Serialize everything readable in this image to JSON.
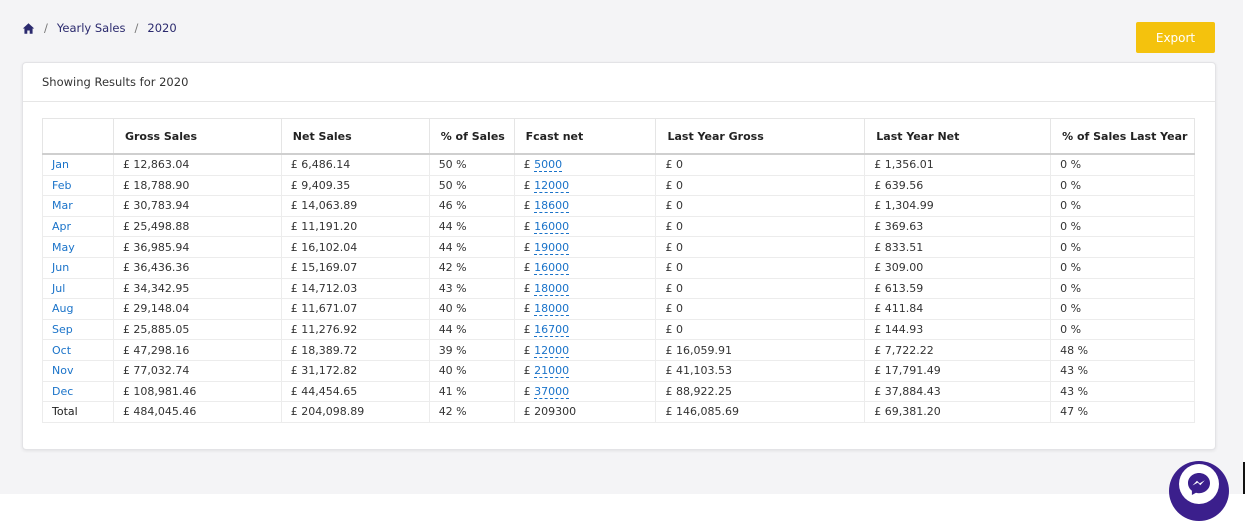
{
  "breadcrumb": {
    "home_icon": "home-icon",
    "separator": "/",
    "section": "Yearly Sales",
    "current": "2020"
  },
  "toolbar": {
    "export_label": "Export"
  },
  "card": {
    "header": "Showing Results for 2020"
  },
  "table": {
    "columns": [
      "",
      "Gross Sales",
      "Net Sales",
      "% of Sales",
      "Fcast net",
      "Last Year Gross",
      "Last Year Net",
      "% of Sales Last Year"
    ],
    "fcast_prefix": "£",
    "rows": [
      {
        "month": "Jan",
        "gross": "£ 12,863.04",
        "net": "£ 6,486.14",
        "pct": "50 %",
        "fcast": "5000",
        "ly_gross": "£ 0",
        "ly_net": "£ 1,356.01",
        "ly_pct": "0 %"
      },
      {
        "month": "Feb",
        "gross": "£ 18,788.90",
        "net": "£ 9,409.35",
        "pct": "50 %",
        "fcast": "12000",
        "ly_gross": "£ 0",
        "ly_net": "£ 639.56",
        "ly_pct": "0 %"
      },
      {
        "month": "Mar",
        "gross": "£ 30,783.94",
        "net": "£ 14,063.89",
        "pct": "46 %",
        "fcast": "18600",
        "ly_gross": "£ 0",
        "ly_net": "£ 1,304.99",
        "ly_pct": "0 %"
      },
      {
        "month": "Apr",
        "gross": "£ 25,498.88",
        "net": "£ 11,191.20",
        "pct": "44 %",
        "fcast": "16000",
        "ly_gross": "£ 0",
        "ly_net": "£ 369.63",
        "ly_pct": "0 %"
      },
      {
        "month": "May",
        "gross": "£ 36,985.94",
        "net": "£ 16,102.04",
        "pct": "44 %",
        "fcast": "19000",
        "ly_gross": "£ 0",
        "ly_net": "£ 833.51",
        "ly_pct": "0 %"
      },
      {
        "month": "Jun",
        "gross": "£ 36,436.36",
        "net": "£ 15,169.07",
        "pct": "42 %",
        "fcast": "16000",
        "ly_gross": "£ 0",
        "ly_net": "£ 309.00",
        "ly_pct": "0 %"
      },
      {
        "month": "Jul",
        "gross": "£ 34,342.95",
        "net": "£ 14,712.03",
        "pct": "43 %",
        "fcast": "18000",
        "ly_gross": "£ 0",
        "ly_net": "£ 613.59",
        "ly_pct": "0 %"
      },
      {
        "month": "Aug",
        "gross": "£ 29,148.04",
        "net": "£ 11,671.07",
        "pct": "40 %",
        "fcast": "18000",
        "ly_gross": "£ 0",
        "ly_net": "£ 411.84",
        "ly_pct": "0 %"
      },
      {
        "month": "Sep",
        "gross": "£ 25,885.05",
        "net": "£ 11,276.92",
        "pct": "44 %",
        "fcast": "16700",
        "ly_gross": "£ 0",
        "ly_net": "£ 144.93",
        "ly_pct": "0 %"
      },
      {
        "month": "Oct",
        "gross": "£ 47,298.16",
        "net": "£ 18,389.72",
        "pct": "39 %",
        "fcast": "12000",
        "ly_gross": "£ 16,059.91",
        "ly_net": "£ 7,722.22",
        "ly_pct": "48 %"
      },
      {
        "month": "Nov",
        "gross": "£ 77,032.74",
        "net": "£ 31,172.82",
        "pct": "40 %",
        "fcast": "21000",
        "ly_gross": "£ 41,103.53",
        "ly_net": "£ 17,791.49",
        "ly_pct": "43 %"
      },
      {
        "month": "Dec",
        "gross": "£ 108,981.46",
        "net": "£ 44,454.65",
        "pct": "41 %",
        "fcast": "37000",
        "ly_gross": "£ 88,922.25",
        "ly_net": "£ 37,884.43",
        "ly_pct": "43 %"
      }
    ],
    "total": {
      "label": "Total",
      "gross": "£ 484,045.46",
      "net": "£ 204,098.89",
      "pct": "42 %",
      "fcast": "£ 209300",
      "ly_gross": "£ 146,085.69",
      "ly_net": "£ 69,381.20",
      "ly_pct": "47 %"
    }
  },
  "colors": {
    "accent": "#f4c20d",
    "link": "#1a73c9",
    "breadcrumb": "#2b2a6e",
    "chat": "#3b1f8c"
  },
  "chat": {
    "icon": "chat-icon"
  }
}
